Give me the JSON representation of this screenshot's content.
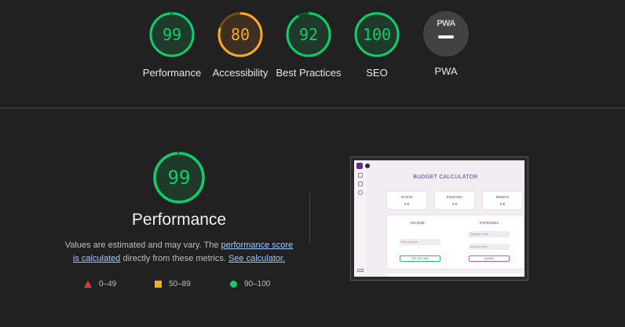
{
  "colors": {
    "pass": "#0cce6b",
    "average": "#ffa726",
    "fail": "#e53935",
    "background": "#212121"
  },
  "categories": [
    {
      "label": "Performance",
      "score": 99,
      "status": "pass"
    },
    {
      "label": "Accessibility",
      "score": 80,
      "status": "average"
    },
    {
      "label": "Best Practices",
      "score": 92,
      "status": "pass"
    },
    {
      "label": "SEO",
      "score": 100,
      "status": "pass"
    }
  ],
  "pwa": {
    "label": "PWA",
    "badge_text": "PWA"
  },
  "summary": {
    "score": 99,
    "title": "Performance",
    "desc_prefix": "Values are estimated and may vary. The ",
    "link_score": "performance score is calculated",
    "desc_middle": " directly from these metrics. ",
    "link_calculator": "See calculator."
  },
  "legend": [
    {
      "label": "0–49",
      "shape": "triangle"
    },
    {
      "label": "50–89",
      "shape": "square"
    },
    {
      "label": "90–100",
      "shape": "circle"
    }
  ],
  "screenshot": {
    "app_title": "BUDGET CALCULATOR",
    "cards": [
      {
        "title": "Income",
        "value": "0 €"
      },
      {
        "title": "Expenses",
        "value": "0 €"
      },
      {
        "title": "Balance",
        "value": "0 €"
      }
    ],
    "income_heading": "INCOME",
    "expenses_heading": "EXPENSES",
    "income_placeholder": "Enter income",
    "expense_name_placeholder": "Expense name",
    "amount_placeholder": "Amount spent",
    "set_income_button": "SET INCOME",
    "submit_button": "SUBMIT"
  }
}
